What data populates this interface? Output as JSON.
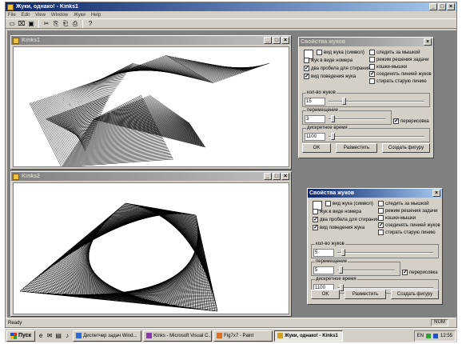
{
  "main_window": {
    "title": "Жуки, однако! - Kinks1"
  },
  "window_controls": {
    "minimize": "_",
    "maximize": "□",
    "close": "×"
  },
  "menu": [
    {
      "label": "File"
    },
    {
      "label": "Edit"
    },
    {
      "label": "View"
    },
    {
      "label": "Window"
    },
    {
      "label": "Жуки"
    },
    {
      "label": "Help"
    }
  ],
  "toolbar": {
    "icons": [
      "new-file-icon",
      "open-folder-icon",
      "save-icon",
      "cut-icon",
      "copy-icon",
      "paste-icon",
      "print-icon",
      "help-icon"
    ],
    "glyphs": [
      "▭",
      "⌧",
      "▣",
      "✂",
      "⎘",
      "⎗",
      "⎙",
      "?"
    ]
  },
  "child_windows": [
    {
      "title": "Kinks1"
    },
    {
      "title": "Kinks2"
    }
  ],
  "dialogs": [
    {
      "title": "Свойства жуков",
      "checkboxes_left": [
        {
          "label": "вид жука (символ)",
          "checked": false
        },
        {
          "label": "жук в виде номера",
          "checked": false
        },
        {
          "label": "два пробела для стирания",
          "checked": true
        },
        {
          "label": "вид поведения жука",
          "checked": true
        }
      ],
      "checkboxes_right": [
        {
          "label": "следить за мышкой",
          "checked": false
        },
        {
          "label": "режим решения задачи",
          "checked": false
        },
        {
          "label": "кошки-мышки",
          "checked": false
        },
        {
          "label": "соединять линией жуков",
          "checked": true
        },
        {
          "label": "стирать старую линию",
          "checked": false
        }
      ],
      "count_label": "кол-во жуков",
      "count_value": "15",
      "count_level": 0.15,
      "move_label": "перемещение",
      "move_value": "3",
      "move_level": 0.05,
      "redraw_label": "перерисовка",
      "redraw_checked": true,
      "time_label": "дискретное время",
      "time_value": "1100",
      "time_level": 0.03,
      "ok_label": "OK",
      "arrange_label": "Разместить",
      "shape_label": "Создать фигуру"
    },
    {
      "title": "Свойства жуков",
      "checkboxes_left": [
        {
          "label": "вид жука (символ)",
          "checked": false
        },
        {
          "label": "жук в виде номера",
          "checked": false
        },
        {
          "label": "два пробела для стирания",
          "checked": true
        },
        {
          "label": "вид поведения жука",
          "checked": true
        }
      ],
      "checkboxes_right": [
        {
          "label": "следить за мышкой",
          "checked": false
        },
        {
          "label": "режим решения задачи",
          "checked": false
        },
        {
          "label": "кошки-мышки",
          "checked": false
        },
        {
          "label": "соединять линией жуков",
          "checked": true
        },
        {
          "label": "стирать старую линию",
          "checked": false
        }
      ],
      "count_label": "кол-во жуков",
      "count_value": "5",
      "count_level": 0.04,
      "move_label": "перемещение",
      "move_value": "5",
      "move_level": 0.03,
      "redraw_label": "перерисовка",
      "redraw_checked": true,
      "time_label": "дискретное время",
      "time_value": "1100",
      "time_level": 0.03,
      "ok_label": "OK",
      "arrange_label": "Разместить",
      "shape_label": "Создать фигуру"
    }
  ],
  "status": {
    "text": "Ready",
    "num": "NUM"
  },
  "taskbar": {
    "start_label": "Пуск",
    "quick_launch": [
      "ie-icon",
      "outlook-icon",
      "desktop-icon",
      "media-icon"
    ],
    "quick_glyphs": [
      "e",
      "✉",
      "▤",
      "♪"
    ],
    "tasks": [
      {
        "label": "Диспетчер задач Wind...",
        "active": false,
        "color": "#2a6ad0"
      },
      {
        "label": "Kinks - Microsoft Visual C...",
        "active": false,
        "color": "#8a3ab0"
      },
      {
        "label": "Fig7x7 - Paint",
        "active": false,
        "color": "#e07020"
      },
      {
        "label": "Жуки, однако! - Kinks1",
        "active": true,
        "color": "#d0a020"
      }
    ],
    "tray_lang": "EN",
    "clock": "12:55"
  }
}
